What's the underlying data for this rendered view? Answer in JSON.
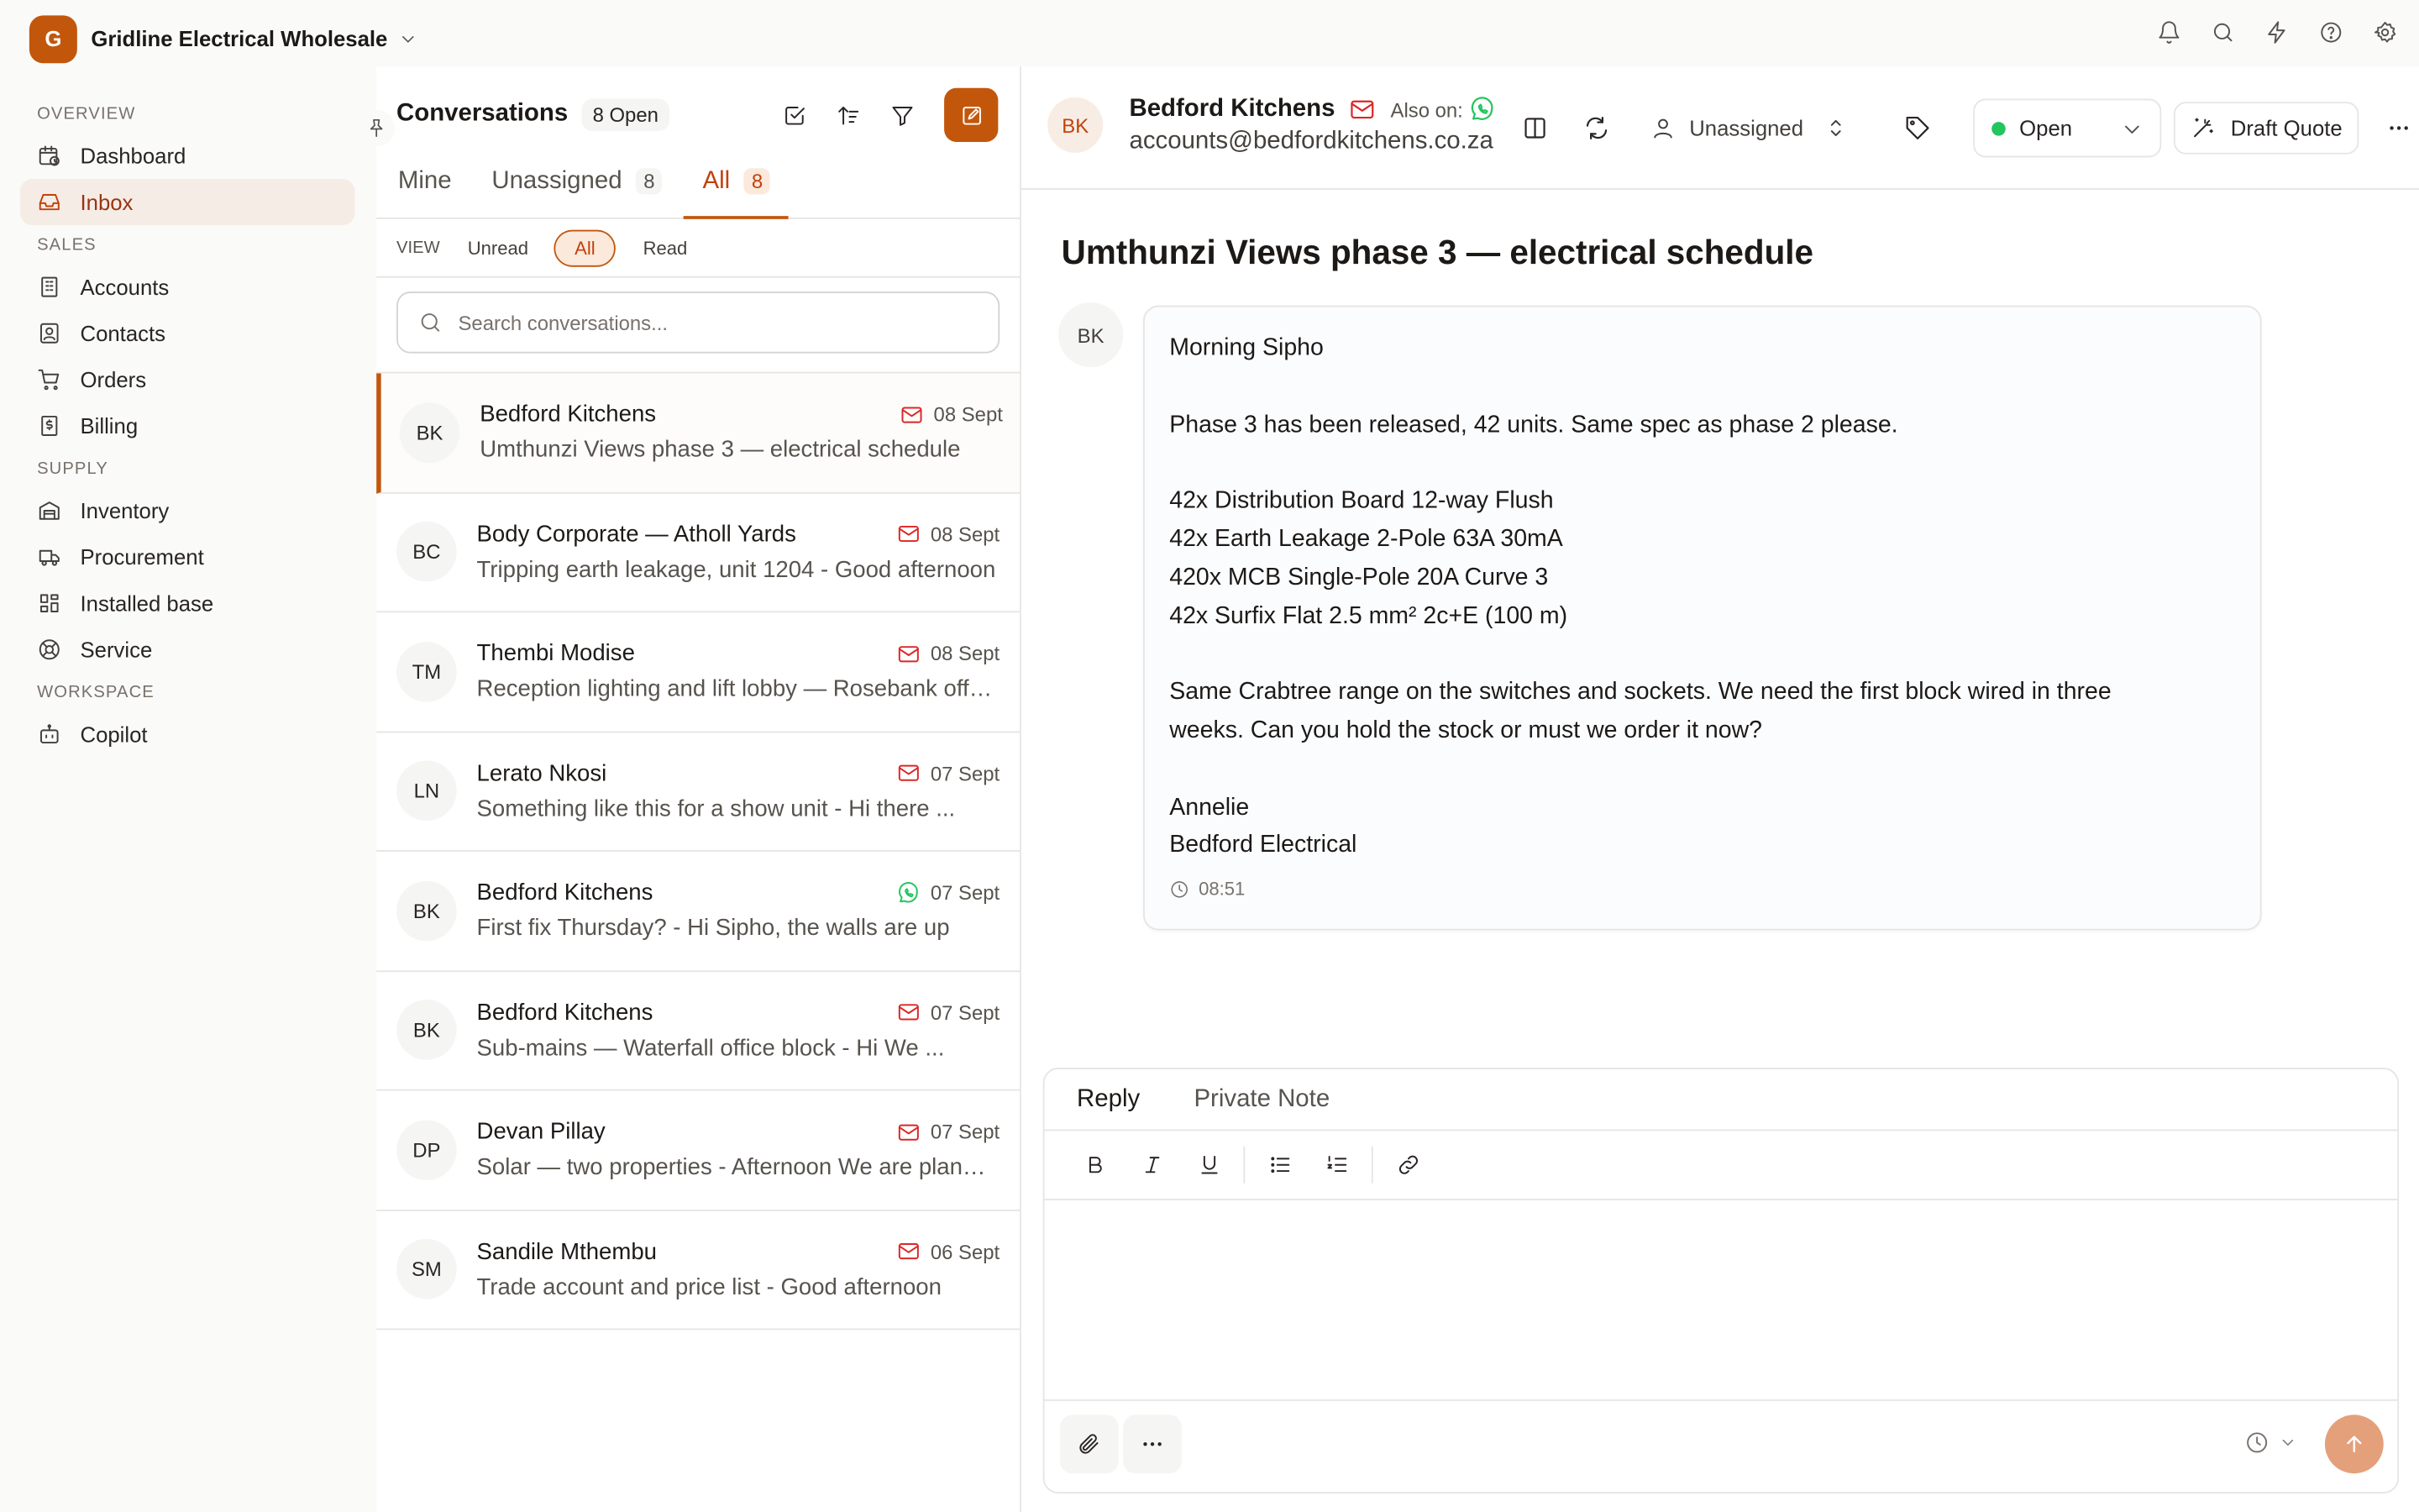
{
  "org": {
    "initial": "G",
    "name": "Gridline Electrical Wholesale"
  },
  "top_actions": [
    "bell-icon",
    "search-icon",
    "zap-icon",
    "help-icon",
    "settings-icon"
  ],
  "sidebar": {
    "overview_label": "OVERVIEW",
    "sales_label": "SALES",
    "supply_label": "SUPPLY",
    "workspace_label": "WORKSPACE",
    "items": {
      "dashboard": "Dashboard",
      "inbox": "Inbox",
      "accounts": "Accounts",
      "contacts": "Contacts",
      "orders": "Orders",
      "billing": "Billing",
      "inventory": "Inventory",
      "procurement": "Procurement",
      "installed_base": "Installed base",
      "service": "Service",
      "copilot": "Copilot"
    },
    "active": "inbox"
  },
  "conversations": {
    "title": "Conversations",
    "open_count": "8 Open",
    "tabs": [
      {
        "label": "Mine",
        "count": ""
      },
      {
        "label": "Unassigned",
        "count": "8"
      },
      {
        "label": "All",
        "count": "8"
      }
    ],
    "active_tab": "All",
    "view": {
      "label": "VIEW",
      "unread": "Unread",
      "all": "All",
      "read": "Read",
      "active": "All"
    },
    "search_placeholder": "Search conversations...",
    "items": [
      {
        "initials": "BK",
        "name": "Bedford Kitchens",
        "channel": "email",
        "date": "08 Sept",
        "preview": "Umthunzi Views phase 3 — electrical schedule",
        "active": true
      },
      {
        "initials": "BC",
        "name": "Body Corporate — Atholl Yards",
        "channel": "email",
        "date": "08 Sept",
        "preview": "Tripping earth leakage, unit 1204 - Good afternoon"
      },
      {
        "initials": "TM",
        "name": "Thembi Modise",
        "channel": "email",
        "date": "08 Sept",
        "preview": "Reception lighting and lift lobby — Rosebank office"
      },
      {
        "initials": "LN",
        "name": "Lerato Nkosi",
        "channel": "email",
        "date": "07 Sept",
        "preview": "Something like this for a show unit - Hi there ..."
      },
      {
        "initials": "BK",
        "name": "Bedford Kitchens",
        "channel": "whatsapp",
        "date": "07 Sept",
        "preview": "First fix Thursday? - Hi Sipho, the walls are up"
      },
      {
        "initials": "BK",
        "name": "Bedford Kitchens",
        "channel": "email",
        "date": "07 Sept",
        "preview": "Sub-mains — Waterfall office block - Hi We ..."
      },
      {
        "initials": "DP",
        "name": "Devan Pillay",
        "channel": "email",
        "date": "07 Sept",
        "preview": "Solar — two properties - Afternoon We are planning"
      },
      {
        "initials": "SM",
        "name": "Sandile Mthembu",
        "channel": "email",
        "date": "06 Sept",
        "preview": "Trade account and price list - Good afternoon"
      }
    ]
  },
  "detail": {
    "contact_initials": "BK",
    "contact_name": "Bedford Kitchens",
    "also_on": "Also on:",
    "email": "accounts@bedfordkitchens.co.za",
    "assignee": "Unassigned",
    "status": "Open",
    "draft_quote": "Draft Quote",
    "subject": "Umthunzi Views phase 3 — electrical schedule",
    "message": {
      "sender_initials": "BK",
      "lines": [
        "Morning Sipho",
        "",
        "Phase 3 has been released, 42 units. Same spec as phase 2 please.",
        "",
        "42x Distribution Board 12-way Flush",
        "42x Earth Leakage 2-Pole 63A 30mA",
        "420x MCB Single-Pole 20A Curve 3",
        "42x Surfix Flat 2.5 mm² 2c+E (100 m)",
        "",
        "Same Crabtree range on the switches and sockets. We need the first block wired in three",
        "weeks. Can you hold the stock or must we order it now?",
        "",
        "Annelie",
        "Bedford Electrical"
      ],
      "time": "08:51"
    }
  },
  "reply": {
    "tab_reply": "Reply",
    "tab_note": "Private Note",
    "active_tab": "Reply",
    "editor_value": ""
  },
  "colors": {
    "accent": "#c2570c",
    "email": "#dc2626",
    "whatsapp": "#22c55e",
    "status_open": "#22c55e"
  }
}
